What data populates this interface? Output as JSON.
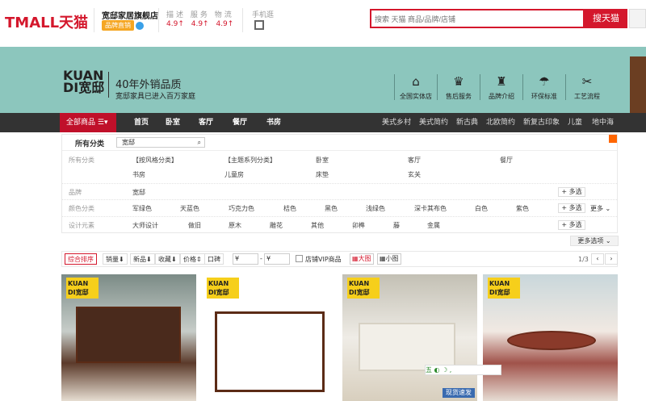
{
  "header": {
    "logo": "TMALL天猫",
    "shop_name": "宽邸家居旗舰店",
    "badge": "品牌直销",
    "rating_title": "描述 服务 物流",
    "ratings": [
      "4.9↑",
      "4.9↑",
      "4.9↑"
    ],
    "mobile_label": "手机逛",
    "search_placeholder": "搜索 天猫 商品/品牌/店铺",
    "search_button": "搜天猫"
  },
  "banner": {
    "brand_logo_line1": "KUAN",
    "brand_logo_line2": "DI宽邸",
    "slogan_main": "40年外销品质",
    "slogan_sub": "宽邸家具已进入百万家庭",
    "features": [
      "全国实体店",
      "售后服务",
      "品牌介绍",
      "环保标准",
      "工艺流程"
    ],
    "feature_icons": [
      "store-icon",
      "crown-icon",
      "trophy-icon",
      "umbrella-icon",
      "tools-icon"
    ]
  },
  "nav": {
    "all_products": "全部商品",
    "items": [
      "首页",
      "卧室",
      "客厅",
      "餐厅",
      "书房"
    ],
    "right_items": [
      "美式乡村",
      "美式简约",
      "新古典",
      "北欧简约",
      "新复古印象",
      "儿童",
      "地中海"
    ]
  },
  "filter": {
    "all_categories": "所有分类",
    "current_tag": "宽邸",
    "category_label": "所有分类",
    "category_values": [
      "【按风格分类】",
      "【主题系列分类】",
      "卧室",
      "客厅",
      "餐厅",
      "书房",
      "儿童房",
      "床垫",
      "玄关"
    ],
    "brand_label": "品牌",
    "brand_values": [
      "宽邸"
    ],
    "color_label": "颜色分类",
    "color_values": [
      "军绿色",
      "天蓝色",
      "巧克力色",
      "桔色",
      "黑色",
      "浅绿色",
      "深卡其布色",
      "白色",
      "紫色"
    ],
    "design_label": "设计元素",
    "design_values": [
      "大师设计",
      "做旧",
      "原木",
      "雕花",
      "其他",
      "卯榫",
      "藤",
      "金属"
    ],
    "multi_select": "+ 多选",
    "more": "更多",
    "more_options": "更多选项"
  },
  "sort": {
    "items": [
      "综合排序",
      "销量",
      "新品",
      "收藏",
      "价格",
      "口碑"
    ],
    "price_from": "¥",
    "price_to": "¥",
    "vip_label": "店铺VIP商品",
    "view_large": "大图",
    "view_small": "小图",
    "page_info": "1/3",
    "prev": "‹",
    "next": "›"
  },
  "products": [
    {
      "badge": "KUAN DI宽邸"
    },
    {
      "badge": "KUAN DI宽邸"
    },
    {
      "badge": "KUAN DI宽邸"
    },
    {
      "badge": "KUAN DI宽邸"
    }
  ],
  "overlay": {
    "ime_text": "五 ◐ ☽ ,",
    "shipping_tag": "现货速发"
  },
  "colors": {
    "tmall_red": "#d4172c",
    "banner_teal": "#8cc6bd",
    "nav_dark": "#333333",
    "badge_yellow": "#f6cf1b"
  }
}
